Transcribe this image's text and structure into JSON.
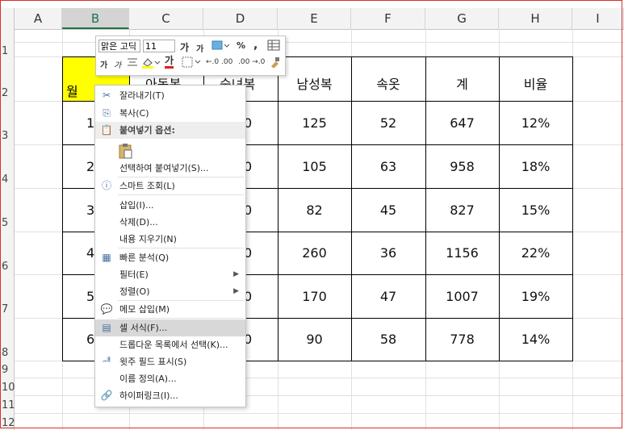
{
  "columns": [
    "A",
    "B",
    "C",
    "D",
    "E",
    "F",
    "G",
    "H",
    "I"
  ],
  "rows": [
    "1",
    "2",
    "3",
    "4",
    "5",
    "6",
    "7",
    "8",
    "9",
    "10",
    "11",
    "12"
  ],
  "table": {
    "headers": [
      "월",
      "아동복",
      "숙녀복",
      "남성복",
      "속옷",
      "계",
      "비율"
    ],
    "partial_months": [
      "1",
      "2",
      "3",
      "4",
      "5",
      "6"
    ],
    "partial_d": [
      "0",
      "0",
      "0",
      "0",
      "0",
      "0"
    ],
    "rows": [
      {
        "e": "125",
        "f": "52",
        "g": "647",
        "h": "12%"
      },
      {
        "e": "105",
        "f": "63",
        "g": "958",
        "h": "18%"
      },
      {
        "e": "82",
        "f": "45",
        "g": "827",
        "h": "15%"
      },
      {
        "e": "260",
        "f": "36",
        "g": "1156",
        "h": "22%"
      },
      {
        "e": "170",
        "f": "47",
        "g": "1007",
        "h": "19%"
      },
      {
        "e": "90",
        "f": "58",
        "g": "778",
        "h": "14%"
      }
    ]
  },
  "mini_toolbar": {
    "font_name": "맑은 고딕",
    "font_size": "11",
    "grow_font": "가",
    "shrink_font": "가",
    "percent": "%",
    "comma": ",",
    "bold": "가",
    "italic": "가",
    "font_color": "가",
    "inc_decimal": "←.0 .00",
    "dec_decimal": ".00 →.0"
  },
  "context_menu": {
    "cut": "잘라내기(T)",
    "copy": "복사(C)",
    "paste_options": "붙여넣기 옵션:",
    "paste_special": "선택하여 붙여넣기(S)...",
    "smart_lookup": "스마트 조회(L)",
    "insert": "삽입(I)...",
    "delete": "삭제(D)...",
    "clear": "내용 지우기(N)",
    "quick_analysis": "빠른 분석(Q)",
    "filter": "필터(E)",
    "sort": "정렬(O)",
    "insert_comment": "메모 삽입(M)",
    "format_cells": "셀 서식(F)...",
    "pick_list": "드롭다운 목록에서 선택(K)...",
    "phonetic": "윗주 필드 표시(S)",
    "define_name": "이름 정의(A)...",
    "hyperlink": "하이퍼링크(I)..."
  },
  "colors": {
    "selected_fill": "#ffff00",
    "header_accent": "#217346",
    "frame": "#d9302c"
  }
}
